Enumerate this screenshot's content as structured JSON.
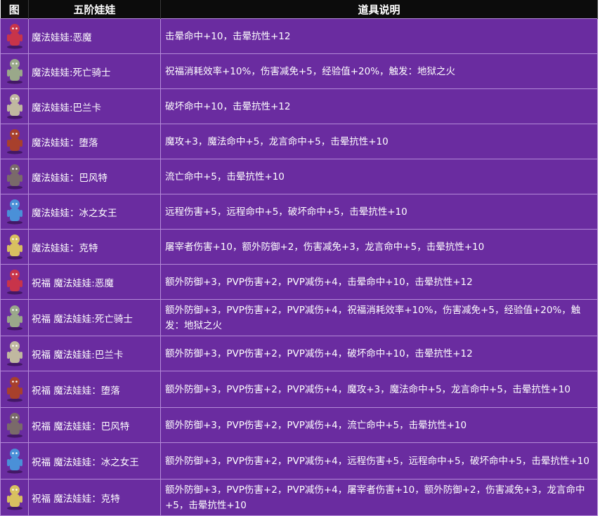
{
  "header": {
    "icon_col": "图",
    "name_col": "五阶娃娃",
    "desc_col": "道具说明"
  },
  "rows": [
    {
      "icon": "demon-doll-icon",
      "tone": "#c8344a",
      "name": "魔法娃娃:恶魔",
      "desc": "击晕命中+10，击晕抗性+12"
    },
    {
      "icon": "death-knight-doll-icon",
      "tone": "#9aa88a",
      "name": "魔法娃娃:死亡骑士",
      "desc": "祝福消耗效率+10%，伤害减免+5，经验值+20%，触发：地狱之火"
    },
    {
      "icon": "baranka-doll-icon",
      "tone": "#c0b8a0",
      "name": "魔法娃娃:巴兰卡",
      "desc": "破坏命中+10，击晕抗性+12"
    },
    {
      "icon": "fallen-doll-icon",
      "tone": "#a8402c",
      "name": "魔法娃娃：堕落",
      "desc": "魔攻+3，魔法命中+5，龙言命中+5，击晕抗性+10"
    },
    {
      "icon": "baphomet-doll-icon",
      "tone": "#7a6a6a",
      "name": "魔法娃娃：巴风特",
      "desc": "流亡命中+5，击晕抗性+10"
    },
    {
      "icon": "ice-queen-doll-icon",
      "tone": "#4a90d8",
      "name": "魔法娃娃：冰之女王",
      "desc": "远程伤害+5，远程命中+5，破坏命中+5，击晕抗性+10"
    },
    {
      "icon": "kurt-doll-icon",
      "tone": "#d8c060",
      "name": "魔法娃娃：克特",
      "desc": "屠宰者伤害+10，额外防御+2，伤害减免+3，龙言命中+5，击晕抗性+10"
    },
    {
      "icon": "demon-doll-icon",
      "tone": "#c8344a",
      "name": "祝福 魔法娃娃:恶魔",
      "desc": "额外防御+3，PVP伤害+2，PVP减伤+4，击晕命中+10，击晕抗性+12"
    },
    {
      "icon": "death-knight-doll-icon",
      "tone": "#9aa88a",
      "name": "祝福 魔法娃娃:死亡骑士",
      "desc": "额外防御+3，PVP伤害+2，PVP减伤+4，祝福消耗效率+10%，伤害减免+5，经验值+20%，触发：地狱之火"
    },
    {
      "icon": "baranka-doll-icon",
      "tone": "#c0b8a0",
      "name": "祝福 魔法娃娃:巴兰卡",
      "desc": "额外防御+3，PVP伤害+2，PVP减伤+4，破坏命中+10，击晕抗性+12"
    },
    {
      "icon": "fallen-doll-icon",
      "tone": "#a8402c",
      "name": "祝福 魔法娃娃：堕落",
      "desc": "额外防御+3，PVP伤害+2，PVP减伤+4，魔攻+3，魔法命中+5，龙言命中+5，击晕抗性+10"
    },
    {
      "icon": "baphomet-doll-icon",
      "tone": "#7a6a6a",
      "name": "祝福 魔法娃娃：巴风特",
      "desc": "额外防御+3，PVP伤害+2，PVP减伤+4，流亡命中+5，击晕抗性+10"
    },
    {
      "icon": "ice-queen-doll-icon",
      "tone": "#4a90d8",
      "name": "祝福 魔法娃娃：冰之女王",
      "desc": "额外防御+3，PVP伤害+2，PVP减伤+4，远程伤害+5，远程命中+5，破坏命中+5，击晕抗性+10"
    },
    {
      "icon": "kurt-doll-icon",
      "tone": "#d8c060",
      "name": "祝福 魔法娃娃：克特",
      "desc": "额外防御+3，PVP伤害+2，PVP减伤+4，屠宰者伤害+10，额外防御+2，伤害减免+3，龙言命中+5，击晕抗性+10"
    }
  ]
}
